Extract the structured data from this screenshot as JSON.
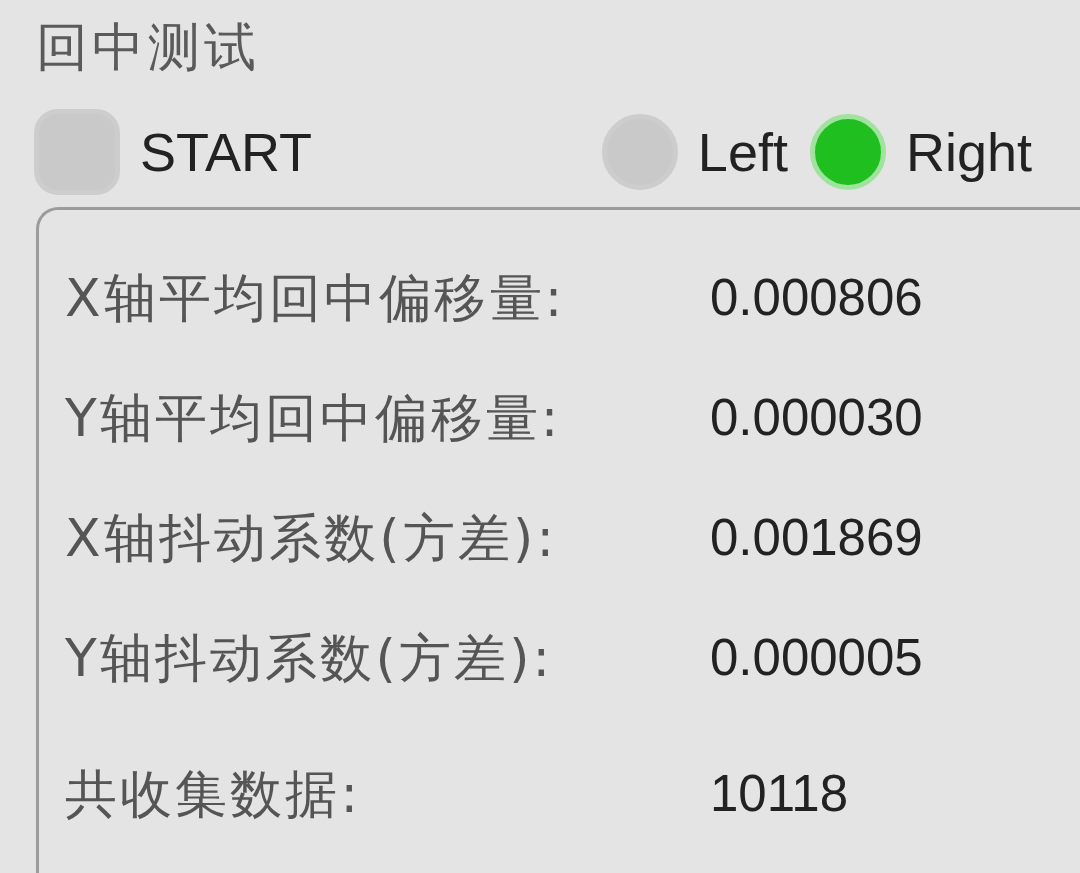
{
  "title": "回中测试",
  "start": {
    "label": "START",
    "on": false
  },
  "sides": [
    {
      "label": "Left",
      "on": false
    },
    {
      "label": "Right",
      "on": true
    }
  ],
  "results": [
    {
      "label": "X轴平均回中偏移量:",
      "value": "0.000806"
    },
    {
      "label": "Y轴平均回中偏移量:",
      "value": "0.000030"
    },
    {
      "label": "X轴抖动系数(方差):",
      "value": "0.001869"
    },
    {
      "label": "Y轴抖动系数(方差):",
      "value": "0.000005"
    },
    {
      "label": "共收集数据:",
      "value": "10118"
    }
  ]
}
